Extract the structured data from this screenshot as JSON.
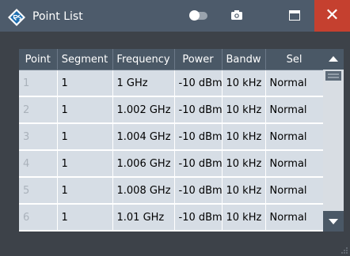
{
  "window": {
    "title": "Point List",
    "close_glyph": "✕"
  },
  "icons": {
    "logo": "rohde-schwarz-logo-icon",
    "toggle": "toggle-icon",
    "camera": "camera-icon",
    "maximize": "maximize-icon",
    "close": "close-icon",
    "scroll_up": "scroll-up-arrow-icon",
    "scroll_down": "scroll-down-arrow-icon",
    "resize_grip": "resize-grip-icon"
  },
  "colors": {
    "titlebar": "#4d5b6b",
    "close_button": "#c5402f",
    "header": "#4a5866",
    "row": "#d6dde5",
    "body_background": "#3d4249"
  },
  "table": {
    "columns": [
      "Point",
      "Segment",
      "Frequency",
      "Power",
      "Bandw",
      "Sel"
    ],
    "rows": [
      {
        "point": "1",
        "segment": "1",
        "frequency": "1 GHz",
        "power": "-10 dBm",
        "bandwidth": "10 kHz",
        "sel": "Normal"
      },
      {
        "point": "2",
        "segment": "1",
        "frequency": "1.002 GHz",
        "power": "-10 dBm",
        "bandwidth": "10 kHz",
        "sel": "Normal"
      },
      {
        "point": "3",
        "segment": "1",
        "frequency": "1.004 GHz",
        "power": "-10 dBm",
        "bandwidth": "10 kHz",
        "sel": "Normal"
      },
      {
        "point": "4",
        "segment": "1",
        "frequency": "1.006 GHz",
        "power": "-10 dBm",
        "bandwidth": "10 kHz",
        "sel": "Normal"
      },
      {
        "point": "5",
        "segment": "1",
        "frequency": "1.008 GHz",
        "power": "-10 dBm",
        "bandwidth": "10 kHz",
        "sel": "Normal"
      },
      {
        "point": "6",
        "segment": "1",
        "frequency": "1.01 GHz",
        "power": "-10 dBm",
        "bandwidth": "10 kHz",
        "sel": "Normal"
      }
    ]
  }
}
